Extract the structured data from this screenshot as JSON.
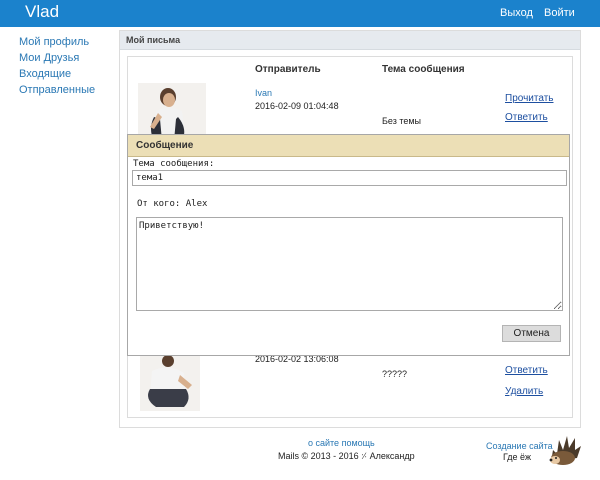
{
  "navbar": {
    "brand": "Vlad",
    "logout": "Выход",
    "login": "Войти"
  },
  "sidebar": {
    "items": [
      {
        "label": "Мой профиль"
      },
      {
        "label": "Мои Друзья"
      },
      {
        "label": "Входящие"
      },
      {
        "label": "Отправленные"
      }
    ]
  },
  "panel": {
    "title": "Мой письма"
  },
  "table": {
    "headers": {
      "sender": "Отправитель",
      "subject": "Тема сообщения"
    },
    "rows": [
      {
        "sender": "Ivan",
        "date": "2016-02-09 01:04:48",
        "subject": "Без темы",
        "actions": [
          "Прочитать",
          "Ответить"
        ]
      },
      {
        "sender": "",
        "date": "2016-02-02 13:06:08",
        "subject": "?????",
        "actions": [
          "Ответить",
          "Удалить"
        ]
      }
    ]
  },
  "modal": {
    "title": "Сообщение",
    "subject_label": "Тема сообщения:",
    "subject_value": "тема1",
    "from_label": "От кого: Alex",
    "body_value": "Приветствую!",
    "cancel_label": "Отмена"
  },
  "footer": {
    "about_link": "о сайте помощь",
    "copyright": "Mails © 2013 - 2016 ⸓ Александр",
    "create_link": "Создание сайта",
    "where": "Где ёж"
  }
}
